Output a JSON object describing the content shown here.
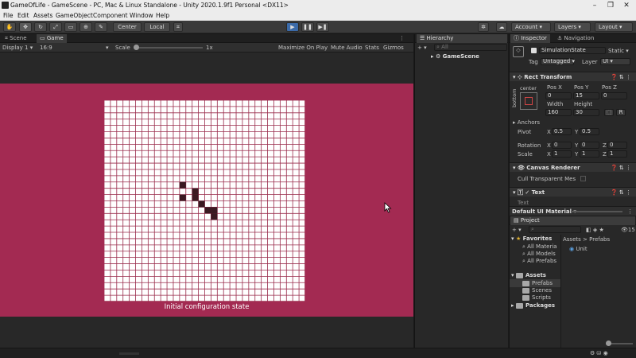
{
  "window": {
    "title": "GameOfLife - GameScene - PC, Mac & Linux Standalone - Unity 2020.1.9f1 Personal <DX11>",
    "minimize": "–",
    "maximize": "❐",
    "close": "✕"
  },
  "menu": [
    "File",
    "Edit",
    "Assets",
    "GameObject",
    "Component",
    "Window",
    "Help"
  ],
  "toolbar": {
    "center": "Center",
    "local": "Local",
    "account": "Account",
    "layers": "Layers",
    "layout": "Layout"
  },
  "scene_tabs": {
    "scene": "Scene",
    "game": "Game"
  },
  "game_bar": {
    "display": "Display 1",
    "aspect": "16:9",
    "scale_label": "Scale",
    "scale_value": "1x",
    "maximize": "Maximize On Play",
    "mute": "Mute Audio",
    "stats": "Stats",
    "gizmos": "Gizmos"
  },
  "game_view": {
    "bg_color": "#a32a52",
    "caption": "Initial configuration state",
    "grid_cols": 32,
    "grid_rows": 32,
    "alive_cells": [
      [
        12,
        13
      ],
      [
        14,
        14
      ],
      [
        12,
        15
      ],
      [
        14,
        15
      ],
      [
        15,
        16
      ],
      [
        16,
        17
      ],
      [
        17,
        17
      ],
      [
        17,
        18
      ]
    ],
    "cell_color": "#3a1a22",
    "line_color": "#9a2c4c"
  },
  "hierarchy": {
    "tab": "Hierarchy",
    "search_placeholder": "All",
    "scene": "GameScene"
  },
  "inspector": {
    "tab": "Inspector",
    "nav_tab": "Navigation",
    "object_name": "SimulationState",
    "static": "Static",
    "tag_label": "Tag",
    "tag": "Untagged",
    "layer_label": "Layer",
    "layer": "UI",
    "rect_transform": "Rect Transform",
    "anchor_h": "center",
    "anchor_v": "bottom",
    "pos_x_label": "Pos X",
    "pos_y_label": "Pos Y",
    "pos_z_label": "Pos Z",
    "pos_x": "0",
    "pos_y": "15",
    "pos_z": "0",
    "width_label": "Width",
    "height_label": "Height",
    "width": "160",
    "height": "30",
    "r_btn": "R",
    "anchors": "Anchors",
    "pivot": "Pivot",
    "pivot_x": "0.5",
    "pivot_y": "0.5",
    "rotation": "Rotation",
    "rot_x": "0",
    "rot_y": "0",
    "rot_z": "0",
    "scale": "Scale",
    "scale_x": "1",
    "scale_y": "1",
    "scale_z": "1",
    "x": "X",
    "y": "Y",
    "z": "Z",
    "canvas_renderer": "Canvas Renderer",
    "cull": "Cull Transparent Mes",
    "text": "Text",
    "text_field": "Text",
    "material": "Default UI Material"
  },
  "project": {
    "tab": "Project",
    "count": "15",
    "favorites": "Favorites",
    "fav_items": [
      "All Materia",
      "All Models",
      "All Prefabs"
    ],
    "assets": "Assets",
    "asset_folders": [
      "Prefabs",
      "Scenes",
      "Scripts"
    ],
    "packages": "Packages",
    "breadcrumb_root": "Assets",
    "breadcrumb_sep": ">",
    "breadcrumb_current": "Prefabs",
    "files": [
      "Unit"
    ]
  }
}
